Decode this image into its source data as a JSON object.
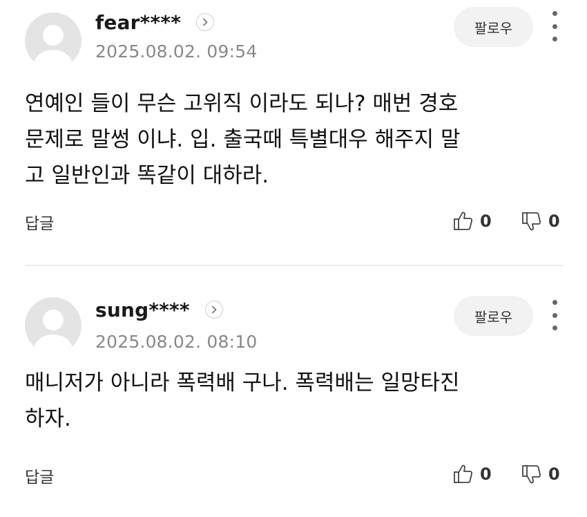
{
  "comments": [
    {
      "username": "fear****",
      "timestamp": "2025.08.02. 09:54",
      "follow_label": "팔로우",
      "body_lines": [
        "연예인 들이 무슨 고위직 이라도 되나? 매번 경호",
        "문제로 말썽 이냐. 입. 출국때 특별대우 해주지 말",
        "고 일반인과 똑같이 대하라."
      ],
      "reply_label": "답글",
      "likes": "0",
      "dislikes": "0"
    },
    {
      "username": "sung****",
      "timestamp": "2025.08.02. 08:10",
      "follow_label": "팔로우",
      "body_lines": [
        "매니저가 아니라 폭력배 구나. 폭력배는 일망타진",
        "하자."
      ],
      "reply_label": "답글",
      "likes": "0",
      "dislikes": "0"
    }
  ],
  "icons": {
    "avatar": "default-avatar-icon",
    "profile": "chevron-right-icon",
    "more": "more-vertical-icon",
    "like": "thumbs-up-icon",
    "dislike": "thumbs-down-icon"
  },
  "colors": {
    "text": "#111111",
    "muted": "#888888",
    "button_bg": "#f2f2f2",
    "avatar_bg": "#e4e4e4",
    "divider": "#ececec"
  }
}
